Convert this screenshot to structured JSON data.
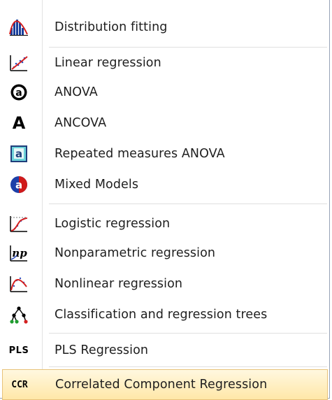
{
  "menu": {
    "items": [
      {
        "label": "Distribution fitting",
        "icon": "distribution-histogram-icon"
      },
      {
        "label": "Linear regression",
        "icon": "linear-regression-icon"
      },
      {
        "label": "ANOVA",
        "icon": "anova-icon"
      },
      {
        "label": "ANCOVA",
        "icon": "ancova-icon"
      },
      {
        "label": "Repeated measures ANOVA",
        "icon": "repeated-measures-icon"
      },
      {
        "label": "Mixed Models",
        "icon": "mixed-models-icon"
      },
      {
        "label": "Logistic regression",
        "icon": "logistic-regression-icon"
      },
      {
        "label": "Nonparametric regression",
        "icon": "nonparametric-regression-icon",
        "icon_text": "np"
      },
      {
        "label": "Nonlinear regression",
        "icon": "nonlinear-regression-icon"
      },
      {
        "label": "Classification and regression trees",
        "icon": "tree-icon"
      },
      {
        "label": "PLS Regression",
        "icon": "pls-icon",
        "icon_text": "PLS"
      },
      {
        "label": "Correlated Component Regression",
        "icon": "ccr-icon",
        "icon_text": "CCR",
        "highlighted": true
      }
    ],
    "icon_glyphs": {
      "anova": "a",
      "ancova": "A",
      "repeated": "a",
      "mixed": "a"
    }
  },
  "colors": {
    "highlight_top": "#fff8e0",
    "highlight_bottom": "#ffe7a8",
    "highlight_border": "#e8c27a",
    "text": "#1e1e1e"
  }
}
